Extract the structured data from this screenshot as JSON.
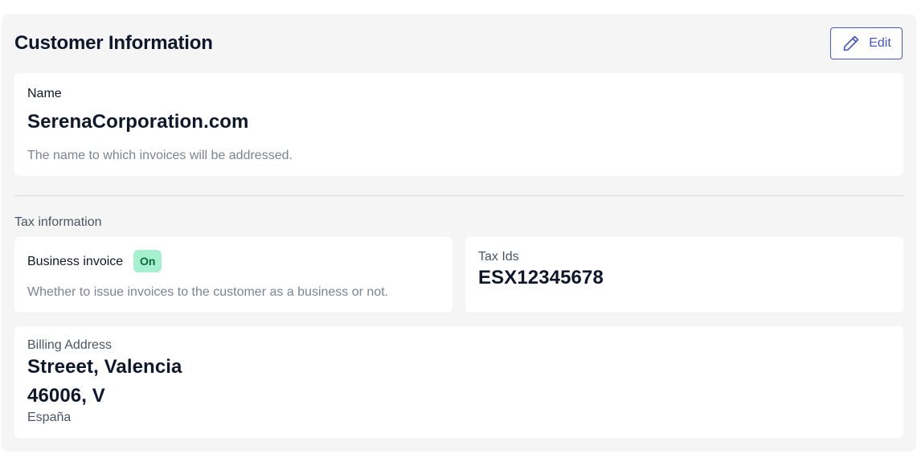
{
  "header": {
    "title": "Customer Information",
    "edit_label": "Edit"
  },
  "name_card": {
    "label": "Name",
    "value": "SerenaCorporation.com",
    "helper": "The name to which invoices will be addressed."
  },
  "tax_section": {
    "label": "Tax information",
    "business_invoice": {
      "label": "Business invoice",
      "status": "On",
      "helper": "Whether to issue invoices to the customer as a business or not."
    },
    "tax_ids": {
      "label": "Tax Ids",
      "value": "ESX12345678"
    }
  },
  "billing_address": {
    "label": "Billing Address",
    "line1": "Streeet, Valencia",
    "line2": "46006, V",
    "country": "España"
  },
  "colors": {
    "accent": "#4556c9",
    "panel_background": "#f5f5f6",
    "badge_background": "#a5f0cf",
    "badge_text": "#10683f"
  },
  "icons": {
    "edit": "pencil-icon"
  }
}
